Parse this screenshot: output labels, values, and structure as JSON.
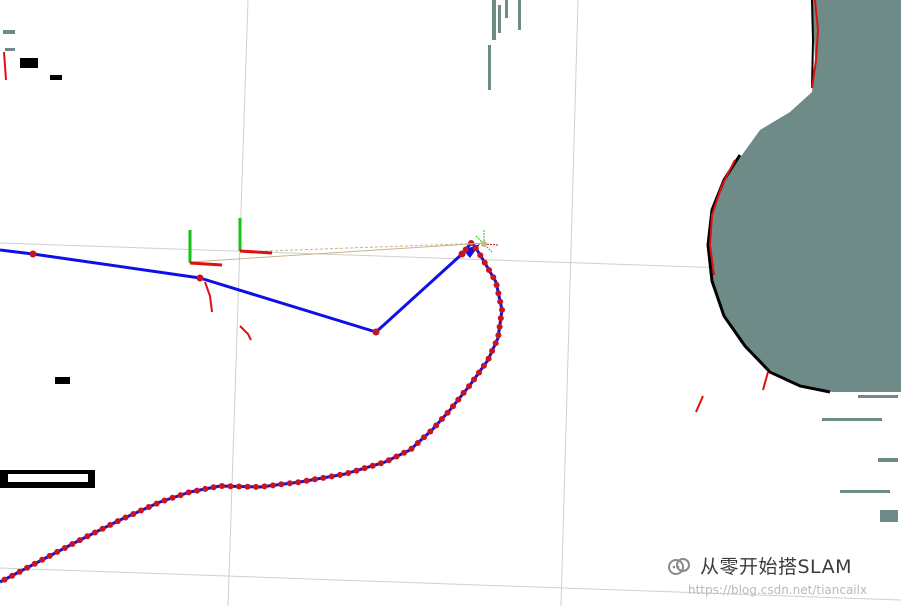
{
  "watermark": {
    "title": "从零开始搭SLAM",
    "url": "https://blog.csdn.net/tiancailx",
    "icon": "wechat-channel-icon"
  },
  "colors": {
    "background": "#ffffff",
    "grid": "#cfcfcf",
    "trajectory": "#1010e6",
    "pose_marker": "#c8141e",
    "scan": "#e01010",
    "occupied": "#000000",
    "unknown_region": "#6f8b87",
    "axis_x": "#e01010",
    "axis_y": "#18c018",
    "link": "#c8b58a"
  }
}
